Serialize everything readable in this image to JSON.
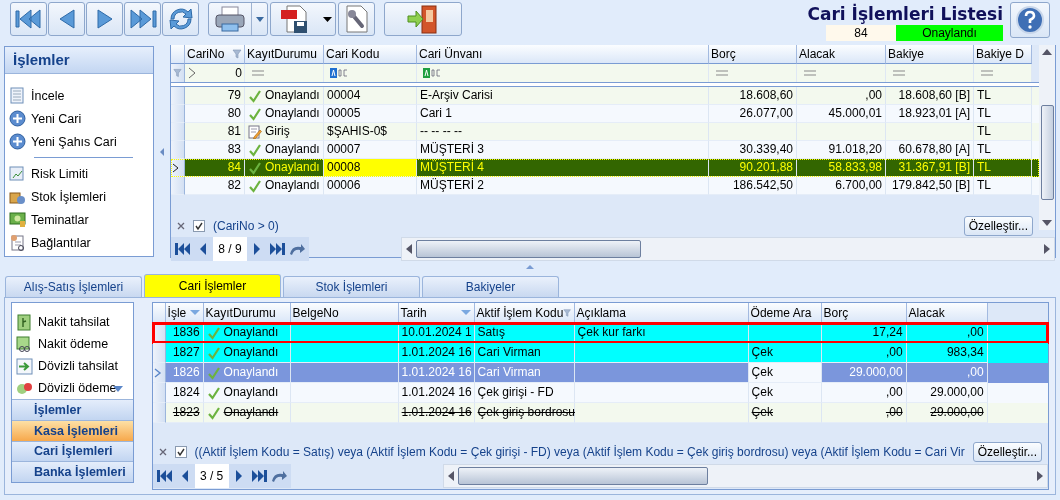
{
  "header": {
    "title": "Cari İşlemleri Listesi",
    "record_no": "84",
    "status": {
      "label": "Onaylandı",
      "color": "#00ff00"
    }
  },
  "side_panel": {
    "title": "İşlemler",
    "items": [
      {
        "kind": "item",
        "label": "İncele"
      },
      {
        "kind": "item",
        "label": "Yeni Cari"
      },
      {
        "kind": "item",
        "label": "Yeni Şahıs Cari"
      },
      {
        "kind": "separator"
      },
      {
        "kind": "item",
        "label": "Risk Limiti"
      },
      {
        "kind": "item",
        "label": "Stok İşlemleri"
      },
      {
        "kind": "item",
        "label": "Teminatlar"
      },
      {
        "kind": "item",
        "label": "Bağlantılar"
      }
    ]
  },
  "accounts_table": {
    "columns": [
      "CariNo",
      "KayıtDurumu",
      "Cari Kodu",
      "Cari Ünvanı",
      "Borç",
      "Alacak",
      "Bakiye",
      "Bakiye D"
    ],
    "filter_row": [
      {
        "kind": "greater",
        "value": "0"
      },
      {
        "kind": "equals"
      },
      {
        "kind": "text"
      },
      {
        "kind": "text"
      },
      {
        "kind": "equals"
      },
      {
        "kind": "equals"
      },
      {
        "kind": "equals"
      },
      {
        "kind": "equals"
      }
    ],
    "rows": [
      {
        "kind": "approved",
        "selected": false,
        "cells": [
          "79",
          "Onaylandı",
          "00004",
          "E-Arşiv Carisi",
          "18.608,60",
          ",00",
          "18.608,60 [B]",
          "TL"
        ]
      },
      {
        "kind": "approved",
        "selected": false,
        "cells": [
          "80",
          "Onaylandı",
          "00005",
          "Cari 1",
          "26.077,00",
          "45.000,01",
          "18.923,01 [A]",
          "TL"
        ]
      },
      {
        "kind": "draft",
        "selected": false,
        "cells": [
          "81",
          "Giriş",
          "$ŞAHIS-0$",
          "-- -- -- --",
          null,
          null,
          null,
          "TL"
        ]
      },
      {
        "kind": "approved",
        "selected": false,
        "cells": [
          "83",
          "Onaylandı",
          "00007",
          "MÜŞTERİ 3",
          "30.339,40",
          "91.018,20",
          "60.678,80 [A]",
          "TL"
        ]
      },
      {
        "kind": "approved",
        "selected": true,
        "cells": [
          "84",
          "Onaylandı",
          "00008",
          "MÜŞTERİ 4",
          "90.201,88",
          "58.833,98",
          "31.367,91 [B]",
          "TL"
        ]
      },
      {
        "kind": "approved",
        "selected": false,
        "cells": [
          "82",
          "Onaylandı",
          "00006",
          "MÜŞTERİ 2",
          "186.542,50",
          "6.700,00",
          "179.842,50 [B]",
          "TL"
        ]
      }
    ],
    "filter": {
      "checked": true,
      "text": "(CariNo > 0)",
      "button": "Özelleştir..."
    },
    "pager": "8 / 9"
  },
  "tabs": [
    {
      "label": "Alış-Satış İşlemleri",
      "selected": false
    },
    {
      "label": "Cari İşlemler",
      "selected": true
    },
    {
      "label": "Stok İşlemleri",
      "selected": false
    },
    {
      "label": "Bakiyeler",
      "selected": false
    }
  ],
  "action_list": [
    "Nakit tahsilat",
    "Nakit ödeme",
    "Dövizli tahsilat",
    "Dövizli ödeme"
  ],
  "groups": [
    {
      "label": "İşlemler",
      "selected": false
    },
    {
      "label": "Kasa İşlemleri",
      "selected": true
    },
    {
      "label": "Cari İşlemleri",
      "selected": false
    },
    {
      "label": "Banka İşlemleri",
      "selected": false
    }
  ],
  "transactions_table": {
    "columns": [
      "İşle",
      "KayıtDurumu",
      "BelgeNo",
      "Tarih",
      "Aktif İşlem Kodu",
      "Açıklama",
      "Ödeme Ara",
      "Borç",
      "Alacak"
    ],
    "rows": [
      {
        "kind": "approved",
        "selected": false,
        "deleted": false,
        "outlined": true,
        "color": "#00ffff",
        "cells": [
          "1836",
          "Onaylandı",
          null,
          "10.01.2024 1",
          "Satış",
          "Çek kur farkı",
          null,
          "17,24",
          ",00"
        ]
      },
      {
        "kind": "approved",
        "selected": false,
        "deleted": false,
        "outlined": false,
        "color": "#00ffff",
        "cells": [
          "1827",
          "Onaylandı",
          null,
          "1.01.2024 16",
          "Cari Virman",
          null,
          "Çek",
          ",00",
          "983,34"
        ]
      },
      {
        "kind": "approved",
        "selected": true,
        "deleted": false,
        "outlined": false,
        "cells": [
          "1826",
          "Onaylandı",
          null,
          "1.01.2024 16",
          "Cari Virman",
          null,
          "Çek",
          "29.000,00",
          ",00"
        ]
      },
      {
        "kind": "approved",
        "selected": false,
        "deleted": false,
        "outlined": false,
        "cells": [
          "1824",
          "Onaylandı",
          null,
          "1.01.2024 16",
          "Çek girişi - FD",
          null,
          "Çek",
          ",00",
          "29.000,00"
        ]
      },
      {
        "kind": "approved",
        "selected": false,
        "deleted": true,
        "outlined": false,
        "cells": [
          "1823",
          "Onaylandı",
          null,
          "1.01.2024 16",
          "Çek giriş bordrosu",
          null,
          "Çek",
          ",00",
          "29.000,00"
        ]
      }
    ],
    "filter": {
      "checked": true,
      "text": "((Aktif İşlem Kodu = Satış) veya (Aktif İşlem Kodu = Çek girişi - FD) veya (Aktif İşlem Kodu = Çek giriş bordrosu) veya (Aktif İşlem Kodu = Cari Vir",
      "button": "Özelleştir..."
    },
    "pager": "3 / 5"
  }
}
